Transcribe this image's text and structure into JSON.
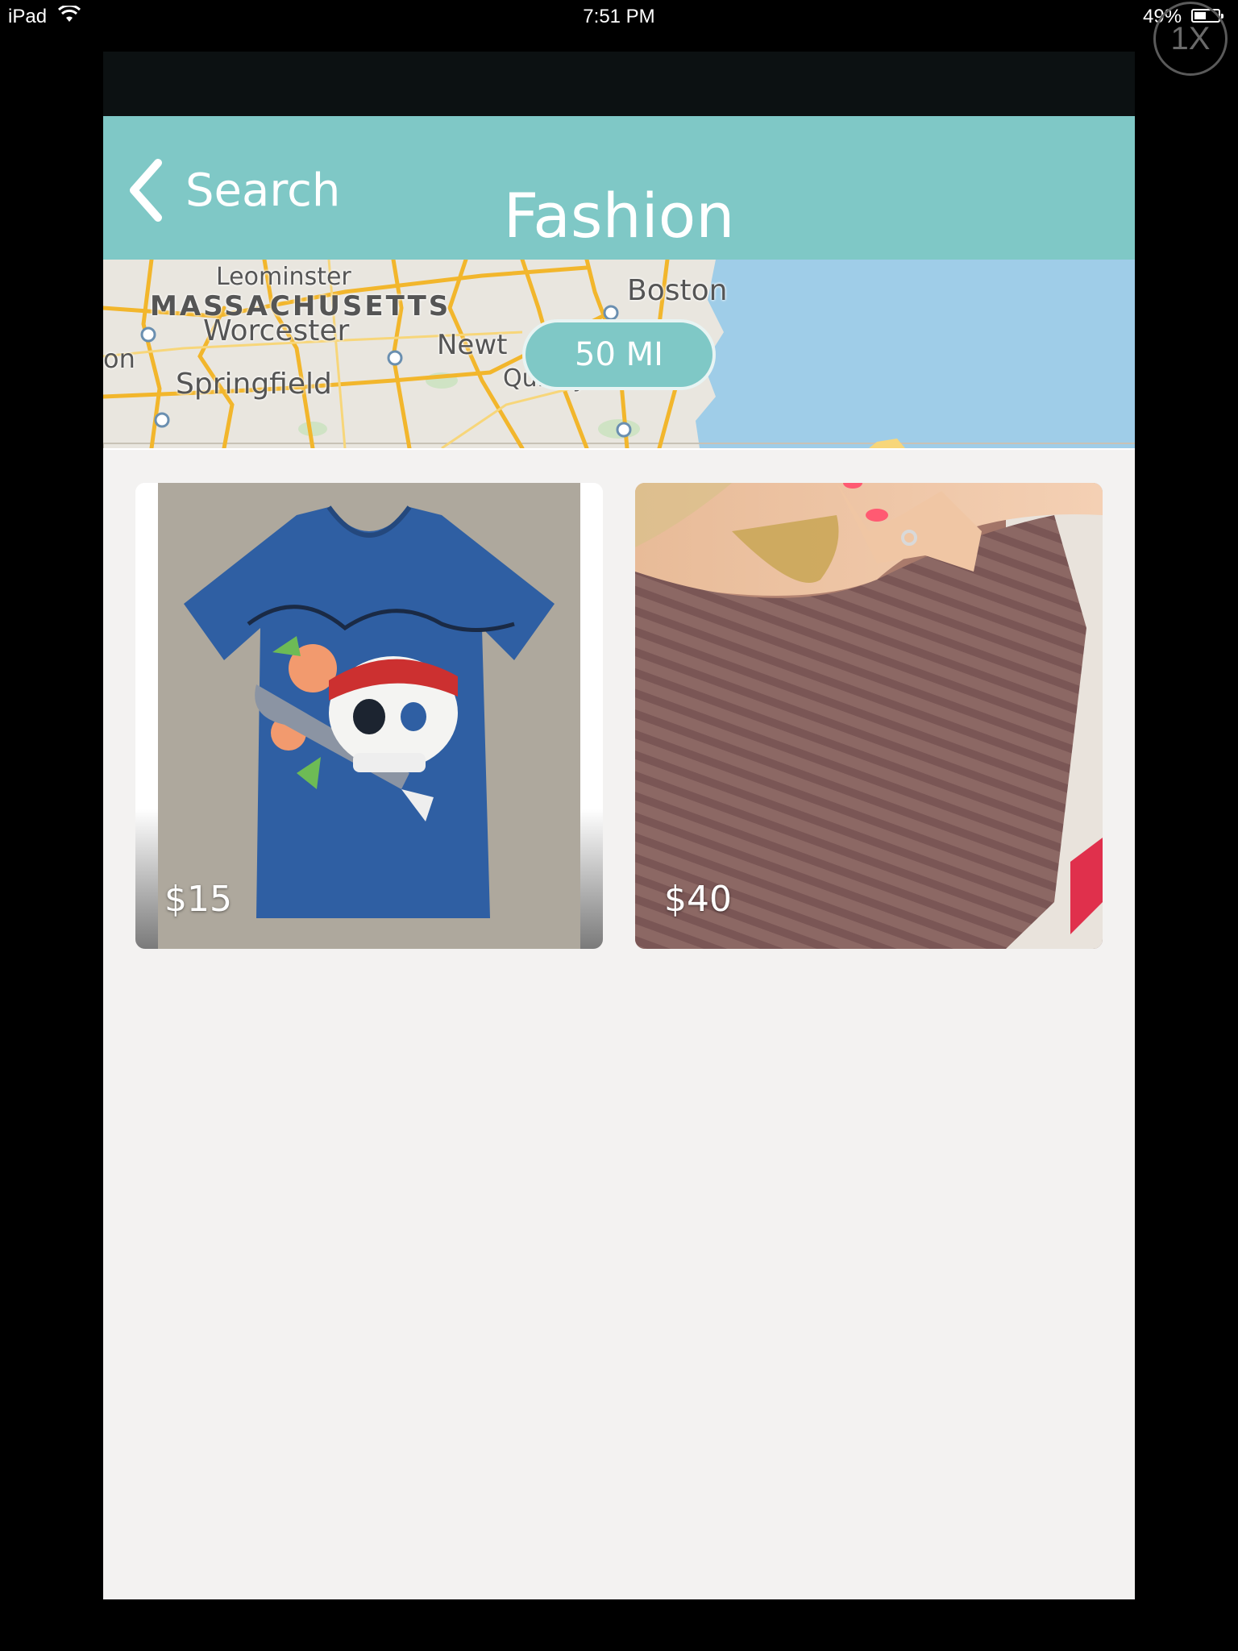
{
  "status_bar": {
    "device": "iPad",
    "time": "7:51 PM",
    "battery_pct": "49%",
    "wifi_icon": "wifi-icon",
    "battery_icon": "battery-icon"
  },
  "zoom_button": {
    "label": "1X"
  },
  "nav": {
    "back_label": "Search",
    "back_icon": "chevron-left-icon",
    "title": "Fashion"
  },
  "map": {
    "labels": [
      "Leominster",
      "MASSACHUSETTS",
      "Worcester",
      "Newt",
      "Boston",
      "Springfield",
      "Quincy",
      "on"
    ],
    "radius": "50 MI"
  },
  "listings": [
    {
      "price": "$15"
    },
    {
      "price": "$40"
    }
  ],
  "colors": {
    "accent": "#7fc8c6",
    "background": "#f3f2f1",
    "top_strip": "#0c1112"
  }
}
